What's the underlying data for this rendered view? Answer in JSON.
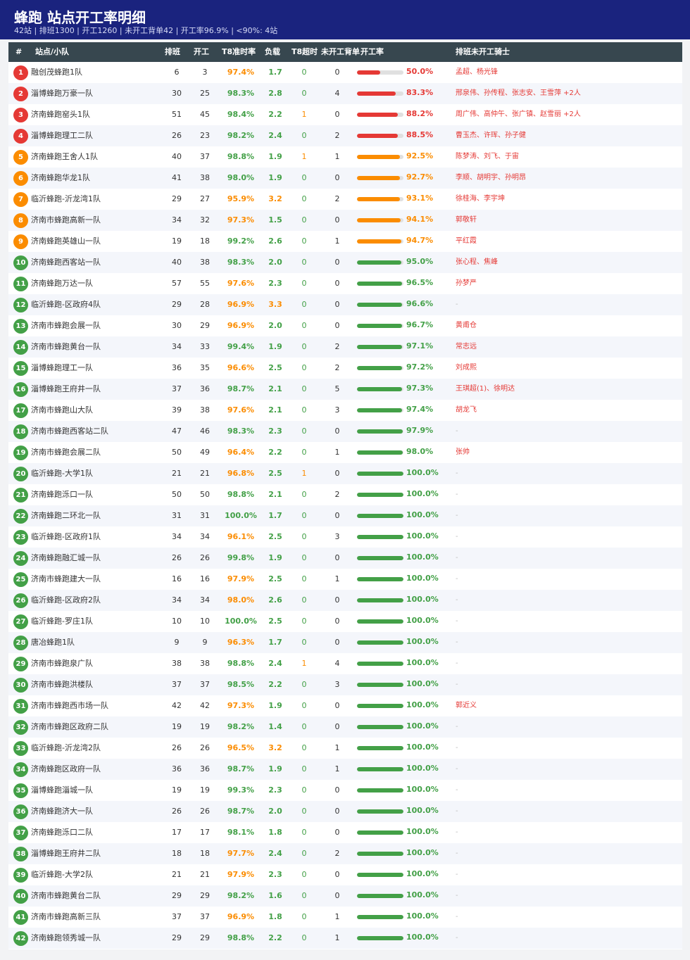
{
  "header": {
    "title": "蜂跑  站点开工率明细",
    "subtitle": "42站 | 排班1300 | 开工1260 | 未开工背单42 | 开工率96.9% | <90%: 4站"
  },
  "columns": {
    "index": "#",
    "station": "站点/小队",
    "scheduled": "排班",
    "started": "开工",
    "t8_rate": "T8准时率",
    "load": "负载",
    "t8_timeout": "T8超时",
    "backlog": "未开工背单",
    "start_rate": "开工率",
    "riders": "排班未开工骑士"
  },
  "colors": {
    "header_bg": "#1a237e",
    "table_header_bg": "#37474f",
    "red": "#e53935",
    "orange": "#fb8c00",
    "green": "#43a047",
    "gray": "#bdbdbd"
  },
  "rows": [
    {
      "rank": "1",
      "name": "融创茂蜂跑1队",
      "scheduled": "6",
      "started": "3",
      "t8": "97.4%",
      "t8_level": "orange",
      "load": "1.7",
      "load_level": "green",
      "timeout": "0",
      "backlog": "0",
      "rate": "50.0%",
      "rate_value": 0.5,
      "level": "red",
      "riders": "孟超、杨光锋"
    },
    {
      "rank": "2",
      "name": "淄博蜂跑万豪一队",
      "scheduled": "30",
      "started": "25",
      "t8": "98.3%",
      "t8_level": "green",
      "load": "2.8",
      "load_level": "green",
      "timeout": "0",
      "backlog": "4",
      "rate": "83.3%",
      "rate_value": 0.833,
      "level": "red",
      "riders": "邢泉伟、孙传程、张志安、王雪萍 +2人"
    },
    {
      "rank": "3",
      "name": "济南蜂跑窑头1队",
      "scheduled": "51",
      "started": "45",
      "t8": "98.4%",
      "t8_level": "green",
      "load": "2.2",
      "load_level": "green",
      "timeout": "1",
      "backlog": "0",
      "rate": "88.2%",
      "rate_value": 0.882,
      "level": "red",
      "riders": "周广伟、高仲午、张广镇、赵雪丽 +2人"
    },
    {
      "rank": "4",
      "name": "淄博蜂跑理工二队",
      "scheduled": "26",
      "started": "23",
      "t8": "98.2%",
      "t8_level": "green",
      "load": "2.4",
      "load_level": "green",
      "timeout": "0",
      "backlog": "2",
      "rate": "88.5%",
      "rate_value": 0.885,
      "level": "red",
      "riders": "曹玉杰、许珲、孙子健"
    },
    {
      "rank": "5",
      "name": "济南蜂跑王舍人1队",
      "scheduled": "40",
      "started": "37",
      "t8": "98.8%",
      "t8_level": "green",
      "load": "1.9",
      "load_level": "green",
      "timeout": "1",
      "backlog": "1",
      "rate": "92.5%",
      "rate_value": 0.925,
      "level": "orange",
      "riders": "陈梦涛、刘飞、于宙"
    },
    {
      "rank": "6",
      "name": "济南蜂跑华龙1队",
      "scheduled": "41",
      "started": "38",
      "t8": "98.0%",
      "t8_level": "green",
      "load": "1.9",
      "load_level": "green",
      "timeout": "0",
      "backlog": "0",
      "rate": "92.7%",
      "rate_value": 0.927,
      "level": "orange",
      "riders": "李顺、胡明宇、孙明昂"
    },
    {
      "rank": "7",
      "name": "临沂蜂跑-沂龙湾1队",
      "scheduled": "29",
      "started": "27",
      "t8": "95.9%",
      "t8_level": "orange",
      "load": "3.2",
      "load_level": "orange",
      "timeout": "0",
      "backlog": "2",
      "rate": "93.1%",
      "rate_value": 0.931,
      "level": "orange",
      "riders": "徐桂海、李宇坤"
    },
    {
      "rank": "8",
      "name": "济南市蜂跑高新一队",
      "scheduled": "34",
      "started": "32",
      "t8": "97.3%",
      "t8_level": "orange",
      "load": "1.5",
      "load_level": "green",
      "timeout": "0",
      "backlog": "0",
      "rate": "94.1%",
      "rate_value": 0.941,
      "level": "orange",
      "riders": "郭敬轩"
    },
    {
      "rank": "9",
      "name": "济南蜂跑英雄山一队",
      "scheduled": "19",
      "started": "18",
      "t8": "99.2%",
      "t8_level": "green",
      "load": "2.6",
      "load_level": "green",
      "timeout": "0",
      "backlog": "1",
      "rate": "94.7%",
      "rate_value": 0.947,
      "level": "orange",
      "riders": "平红霞"
    },
    {
      "rank": "10",
      "name": "济南蜂跑西客站一队",
      "scheduled": "40",
      "started": "38",
      "t8": "98.3%",
      "t8_level": "green",
      "load": "2.0",
      "load_level": "green",
      "timeout": "0",
      "backlog": "0",
      "rate": "95.0%",
      "rate_value": 0.95,
      "level": "green",
      "riders": "张心程、焦峰"
    },
    {
      "rank": "11",
      "name": "济南蜂跑万达一队",
      "scheduled": "57",
      "started": "55",
      "t8": "97.6%",
      "t8_level": "orange",
      "load": "2.3",
      "load_level": "green",
      "timeout": "0",
      "backlog": "0",
      "rate": "96.5%",
      "rate_value": 0.965,
      "level": "green",
      "riders": "孙梦严"
    },
    {
      "rank": "12",
      "name": "临沂蜂跑-区政府4队",
      "scheduled": "29",
      "started": "28",
      "t8": "96.9%",
      "t8_level": "orange",
      "load": "3.3",
      "load_level": "orange",
      "timeout": "0",
      "backlog": "0",
      "rate": "96.6%",
      "rate_value": 0.966,
      "level": "green",
      "riders": "-"
    },
    {
      "rank": "13",
      "name": "济南市蜂跑会展一队",
      "scheduled": "30",
      "started": "29",
      "t8": "96.9%",
      "t8_level": "orange",
      "load": "2.0",
      "load_level": "green",
      "timeout": "0",
      "backlog": "0",
      "rate": "96.7%",
      "rate_value": 0.967,
      "level": "green",
      "riders": "黄甫仓"
    },
    {
      "rank": "14",
      "name": "济南市蜂跑黄台一队",
      "scheduled": "34",
      "started": "33",
      "t8": "99.4%",
      "t8_level": "green",
      "load": "1.9",
      "load_level": "green",
      "timeout": "0",
      "backlog": "2",
      "rate": "97.1%",
      "rate_value": 0.971,
      "level": "green",
      "riders": "常志远"
    },
    {
      "rank": "15",
      "name": "淄博蜂跑理工一队",
      "scheduled": "36",
      "started": "35",
      "t8": "96.6%",
      "t8_level": "orange",
      "load": "2.5",
      "load_level": "green",
      "timeout": "0",
      "backlog": "2",
      "rate": "97.2%",
      "rate_value": 0.972,
      "level": "green",
      "riders": "刘成熙"
    },
    {
      "rank": "16",
      "name": "淄博蜂跑王府井一队",
      "scheduled": "37",
      "started": "36",
      "t8": "98.7%",
      "t8_level": "green",
      "load": "2.1",
      "load_level": "green",
      "timeout": "0",
      "backlog": "5",
      "rate": "97.3%",
      "rate_value": 0.973,
      "level": "green",
      "riders": "王琪超(1)、徐明达"
    },
    {
      "rank": "17",
      "name": "济南市蜂跑山大队",
      "scheduled": "39",
      "started": "38",
      "t8": "97.6%",
      "t8_level": "orange",
      "load": "2.1",
      "load_level": "green",
      "timeout": "0",
      "backlog": "3",
      "rate": "97.4%",
      "rate_value": 0.974,
      "level": "green",
      "riders": "胡龙飞"
    },
    {
      "rank": "18",
      "name": "济南市蜂跑西客站二队",
      "scheduled": "47",
      "started": "46",
      "t8": "98.3%",
      "t8_level": "green",
      "load": "2.3",
      "load_level": "green",
      "timeout": "0",
      "backlog": "0",
      "rate": "97.9%",
      "rate_value": 0.979,
      "level": "green",
      "riders": "-"
    },
    {
      "rank": "19",
      "name": "济南市蜂跑会展二队",
      "scheduled": "50",
      "started": "49",
      "t8": "96.4%",
      "t8_level": "orange",
      "load": "2.2",
      "load_level": "green",
      "timeout": "0",
      "backlog": "1",
      "rate": "98.0%",
      "rate_value": 0.98,
      "level": "green",
      "riders": "张帅"
    },
    {
      "rank": "20",
      "name": "临沂蜂跑-大学1队",
      "scheduled": "21",
      "started": "21",
      "t8": "96.8%",
      "t8_level": "orange",
      "load": "2.5",
      "load_level": "green",
      "timeout": "1",
      "backlog": "0",
      "rate": "100.0%",
      "rate_value": 1,
      "level": "green",
      "riders": "-"
    },
    {
      "rank": "21",
      "name": "济南蜂跑泺口一队",
      "scheduled": "50",
      "started": "50",
      "t8": "98.8%",
      "t8_level": "green",
      "load": "2.1",
      "load_level": "green",
      "timeout": "0",
      "backlog": "2",
      "rate": "100.0%",
      "rate_value": 1,
      "level": "green",
      "riders": "-"
    },
    {
      "rank": "22",
      "name": "济南蜂跑二环北一队",
      "scheduled": "31",
      "started": "31",
      "t8": "100.0%",
      "t8_level": "green",
      "load": "1.7",
      "load_level": "green",
      "timeout": "0",
      "backlog": "0",
      "rate": "100.0%",
      "rate_value": 1,
      "level": "green",
      "riders": "-"
    },
    {
      "rank": "23",
      "name": "临沂蜂跑-区政府1队",
      "scheduled": "34",
      "started": "34",
      "t8": "96.1%",
      "t8_level": "orange",
      "load": "2.5",
      "load_level": "green",
      "timeout": "0",
      "backlog": "3",
      "rate": "100.0%",
      "rate_value": 1,
      "level": "green",
      "riders": "-"
    },
    {
      "rank": "24",
      "name": "济南蜂跑融汇城一队",
      "scheduled": "26",
      "started": "26",
      "t8": "99.8%",
      "t8_level": "green",
      "load": "1.9",
      "load_level": "green",
      "timeout": "0",
      "backlog": "0",
      "rate": "100.0%",
      "rate_value": 1,
      "level": "green",
      "riders": "-"
    },
    {
      "rank": "25",
      "name": "济南市蜂跑建大一队",
      "scheduled": "16",
      "started": "16",
      "t8": "97.9%",
      "t8_level": "orange",
      "load": "2.5",
      "load_level": "green",
      "timeout": "0",
      "backlog": "1",
      "rate": "100.0%",
      "rate_value": 1,
      "level": "green",
      "riders": "-"
    },
    {
      "rank": "26",
      "name": "临沂蜂跑-区政府2队",
      "scheduled": "34",
      "started": "34",
      "t8": "98.0%",
      "t8_level": "orange",
      "load": "2.6",
      "load_level": "green",
      "timeout": "0",
      "backlog": "0",
      "rate": "100.0%",
      "rate_value": 1,
      "level": "green",
      "riders": "-"
    },
    {
      "rank": "27",
      "name": "临沂蜂跑-罗庄1队",
      "scheduled": "10",
      "started": "10",
      "t8": "100.0%",
      "t8_level": "green",
      "load": "2.5",
      "load_level": "green",
      "timeout": "0",
      "backlog": "0",
      "rate": "100.0%",
      "rate_value": 1,
      "level": "green",
      "riders": "-"
    },
    {
      "rank": "28",
      "name": "唐冶蜂跑1队",
      "scheduled": "9",
      "started": "9",
      "t8": "96.3%",
      "t8_level": "orange",
      "load": "1.7",
      "load_level": "green",
      "timeout": "0",
      "backlog": "0",
      "rate": "100.0%",
      "rate_value": 1,
      "level": "green",
      "riders": "-"
    },
    {
      "rank": "29",
      "name": "济南市蜂跑泉广队",
      "scheduled": "38",
      "started": "38",
      "t8": "98.8%",
      "t8_level": "green",
      "load": "2.4",
      "load_level": "green",
      "timeout": "1",
      "backlog": "4",
      "rate": "100.0%",
      "rate_value": 1,
      "level": "green",
      "riders": "-"
    },
    {
      "rank": "30",
      "name": "济南市蜂跑洪楼队",
      "scheduled": "37",
      "started": "37",
      "t8": "98.5%",
      "t8_level": "green",
      "load": "2.2",
      "load_level": "green",
      "timeout": "0",
      "backlog": "3",
      "rate": "100.0%",
      "rate_value": 1,
      "level": "green",
      "riders": "-"
    },
    {
      "rank": "31",
      "name": "济南市蜂跑西市场一队",
      "scheduled": "42",
      "started": "42",
      "t8": "97.3%",
      "t8_level": "orange",
      "load": "1.9",
      "load_level": "green",
      "timeout": "0",
      "backlog": "0",
      "rate": "100.0%",
      "rate_value": 1,
      "level": "green",
      "riders": "郭近义"
    },
    {
      "rank": "32",
      "name": "济南市蜂跑区政府二队",
      "scheduled": "19",
      "started": "19",
      "t8": "98.2%",
      "t8_level": "green",
      "load": "1.4",
      "load_level": "green",
      "timeout": "0",
      "backlog": "0",
      "rate": "100.0%",
      "rate_value": 1,
      "level": "green",
      "riders": "-"
    },
    {
      "rank": "33",
      "name": "临沂蜂跑-沂龙湾2队",
      "scheduled": "26",
      "started": "26",
      "t8": "96.5%",
      "t8_level": "orange",
      "load": "3.2",
      "load_level": "orange",
      "timeout": "0",
      "backlog": "1",
      "rate": "100.0%",
      "rate_value": 1,
      "level": "green",
      "riders": "-"
    },
    {
      "rank": "34",
      "name": "济南蜂跑区政府一队",
      "scheduled": "36",
      "started": "36",
      "t8": "98.7%",
      "t8_level": "green",
      "load": "1.9",
      "load_level": "green",
      "timeout": "0",
      "backlog": "1",
      "rate": "100.0%",
      "rate_value": 1,
      "level": "green",
      "riders": "-"
    },
    {
      "rank": "35",
      "name": "淄博蜂跑淄城一队",
      "scheduled": "19",
      "started": "19",
      "t8": "99.3%",
      "t8_level": "green",
      "load": "2.3",
      "load_level": "green",
      "timeout": "0",
      "backlog": "0",
      "rate": "100.0%",
      "rate_value": 1,
      "level": "green",
      "riders": "-"
    },
    {
      "rank": "36",
      "name": "济南蜂跑济大一队",
      "scheduled": "26",
      "started": "26",
      "t8": "98.7%",
      "t8_level": "green",
      "load": "2.0",
      "load_level": "green",
      "timeout": "0",
      "backlog": "0",
      "rate": "100.0%",
      "rate_value": 1,
      "level": "green",
      "riders": "-"
    },
    {
      "rank": "37",
      "name": "济南蜂跑泺口二队",
      "scheduled": "17",
      "started": "17",
      "t8": "98.1%",
      "t8_level": "green",
      "load": "1.8",
      "load_level": "green",
      "timeout": "0",
      "backlog": "0",
      "rate": "100.0%",
      "rate_value": 1,
      "level": "green",
      "riders": "-"
    },
    {
      "rank": "38",
      "name": "淄博蜂跑王府井二队",
      "scheduled": "18",
      "started": "18",
      "t8": "97.7%",
      "t8_level": "orange",
      "load": "2.4",
      "load_level": "green",
      "timeout": "0",
      "backlog": "2",
      "rate": "100.0%",
      "rate_value": 1,
      "level": "green",
      "riders": "-"
    },
    {
      "rank": "39",
      "name": "临沂蜂跑-大学2队",
      "scheduled": "21",
      "started": "21",
      "t8": "97.9%",
      "t8_level": "orange",
      "load": "2.3",
      "load_level": "green",
      "timeout": "0",
      "backlog": "0",
      "rate": "100.0%",
      "rate_value": 1,
      "level": "green",
      "riders": "-"
    },
    {
      "rank": "40",
      "name": "济南市蜂跑黄台二队",
      "scheduled": "29",
      "started": "29",
      "t8": "98.2%",
      "t8_level": "green",
      "load": "1.6",
      "load_level": "green",
      "timeout": "0",
      "backlog": "0",
      "rate": "100.0%",
      "rate_value": 1,
      "level": "green",
      "riders": "-"
    },
    {
      "rank": "41",
      "name": "济南市蜂跑高新三队",
      "scheduled": "37",
      "started": "37",
      "t8": "96.9%",
      "t8_level": "orange",
      "load": "1.8",
      "load_level": "green",
      "timeout": "0",
      "backlog": "1",
      "rate": "100.0%",
      "rate_value": 1,
      "level": "green",
      "riders": "-"
    },
    {
      "rank": "42",
      "name": "济南蜂跑领秀城一队",
      "scheduled": "29",
      "started": "29",
      "t8": "98.8%",
      "t8_level": "green",
      "load": "2.2",
      "load_level": "green",
      "timeout": "0",
      "backlog": "1",
      "rate": "100.0%",
      "rate_value": 1,
      "level": "green",
      "riders": "-"
    }
  ]
}
